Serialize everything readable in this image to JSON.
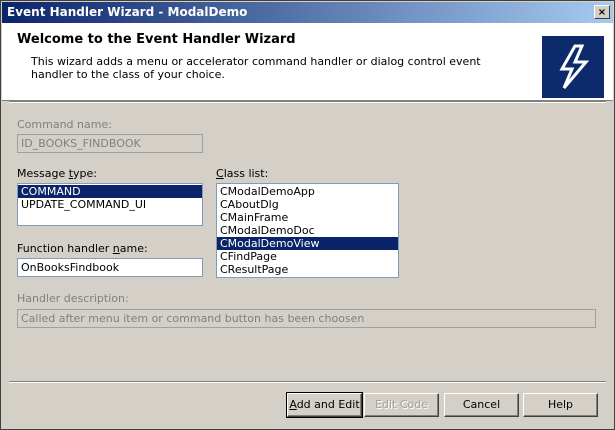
{
  "window": {
    "title": "Event Handler Wizard - ModalDemo",
    "close_glyph": "×"
  },
  "header": {
    "title": "Welcome to the Event Handler Wizard",
    "description": "This wizard adds a menu or accelerator command handler or dialog control event handler to the class of your choice."
  },
  "command_name": {
    "label": "Command name:",
    "value": "ID_BOOKS_FINDBOOK"
  },
  "message_type": {
    "label_pre": "Message ",
    "label_key": "t",
    "label_post": "ype:",
    "items": [
      "COMMAND",
      "UPDATE_COMMAND_UI"
    ],
    "selected": "COMMAND"
  },
  "class_list": {
    "label_pre": "",
    "label_key": "C",
    "label_post": "lass list:",
    "items": [
      "CModalDemoApp",
      "CAboutDlg",
      "CMainFrame",
      "CModalDemoDoc",
      "CModalDemoView",
      "CFindPage",
      "CResultPage"
    ],
    "selected": "CModalDemoView"
  },
  "function_handler": {
    "label_pre": "Function handler ",
    "label_key": "n",
    "label_post": "ame:",
    "value": "OnBooksFindbook"
  },
  "handler_description": {
    "label": "Handler description:",
    "value": "Called after menu item or command button has been choosen"
  },
  "buttons": {
    "add_edit_key": "A",
    "add_edit_rest": "dd and Edit",
    "edit_code": "Edit Code",
    "cancel": "Cancel",
    "help": "Help"
  },
  "colors": {
    "selection": "#0a246a",
    "logo_bg": "#0c2a6c",
    "dialog_bg": "#d4d0c8"
  },
  "icons": {
    "wizard_logo": "lightning-bolt-icon"
  }
}
